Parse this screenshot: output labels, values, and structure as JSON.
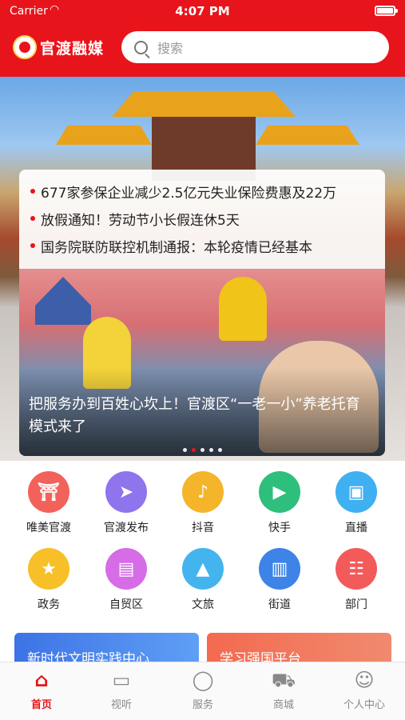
{
  "status_bar": {
    "carrier": "Carrier",
    "time": "4:07 PM"
  },
  "header": {
    "logo_text": "官渡融媒",
    "search_placeholder": "搜索"
  },
  "news": [
    "677家参保企业减少2.5亿元失业保险费惠及22万",
    "放假通知！劳动节小长假连休5天",
    "国务院联防联控机制通报：本轮疫情已经基本"
  ],
  "banner": {
    "caption": "把服务办到百姓心坎上！官渡区“一老一小”养老托育模式来了",
    "dots": 5,
    "active_dot": 1
  },
  "grid": [
    {
      "label": "唯美官渡",
      "icon": "temple-icon",
      "color": "#f3625a",
      "glyph": "⛩"
    },
    {
      "label": "官渡发布",
      "icon": "paper-plane-icon",
      "color": "#8f74ee",
      "glyph": "➤"
    },
    {
      "label": "抖音",
      "icon": "douyin-icon",
      "color": "#f5b52a",
      "glyph": "♪"
    },
    {
      "label": "快手",
      "icon": "kuaishou-icon",
      "color": "#2fbf7c",
      "glyph": "▶"
    },
    {
      "label": "直播",
      "icon": "tv-live-icon",
      "color": "#3fb0f2",
      "glyph": "▣"
    },
    {
      "label": "政务",
      "icon": "star-badge-icon",
      "color": "#f7c028",
      "glyph": "★"
    },
    {
      "label": "自贸区",
      "icon": "briefcase-icon",
      "color": "#d66de6",
      "glyph": "▤"
    },
    {
      "label": "文旅",
      "icon": "landscape-icon",
      "color": "#43b4ee",
      "glyph": "▲"
    },
    {
      "label": "街道",
      "icon": "building-location-icon",
      "color": "#3d83e8",
      "glyph": "▥"
    },
    {
      "label": "部门",
      "icon": "people-icon",
      "color": "#f35b5b",
      "glyph": "☷"
    }
  ],
  "promos": [
    {
      "label": "新时代文明实践中心"
    },
    {
      "label": "学习强国平台"
    }
  ],
  "tabbar": [
    {
      "label": "首页",
      "icon": "home-icon",
      "glyph": "⌂",
      "active": true
    },
    {
      "label": "视听",
      "icon": "tv-icon",
      "glyph": "▭",
      "active": false
    },
    {
      "label": "服务",
      "icon": "chat-icon",
      "glyph": "◯",
      "active": false
    },
    {
      "label": "商城",
      "icon": "cart-icon",
      "glyph": "⛟",
      "active": false
    },
    {
      "label": "个人中心",
      "icon": "user-icon",
      "glyph": "☺",
      "active": false
    }
  ]
}
